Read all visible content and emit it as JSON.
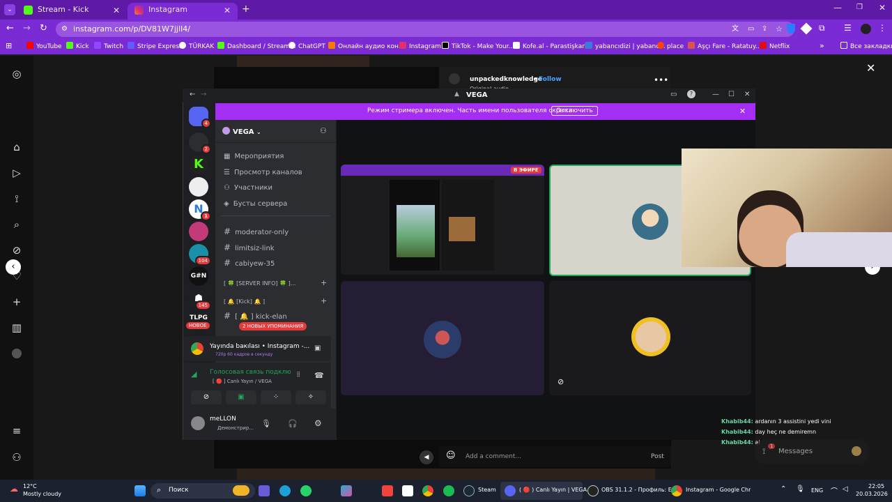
{
  "browser": {
    "tabs": [
      {
        "title": "Stream - Kick Dashboard",
        "color": "#53fc18"
      },
      {
        "title": "Instagram",
        "color": "#e1306c"
      }
    ],
    "url": "instagram.com/p/DV81W7jjlI4/",
    "bookmarks": [
      {
        "label": "YouTube",
        "color": "#ff0000"
      },
      {
        "label": "Kick",
        "color": "#53fc18"
      },
      {
        "label": "Twitch",
        "color": "#9146ff"
      },
      {
        "label": "Stripe Express",
        "color": "#635bff"
      },
      {
        "label": "TÜRKAK",
        "color": "#ffffff"
      },
      {
        "label": "Dashboard / Stream...",
        "color": "#53fc18"
      },
      {
        "label": "ChatGPT",
        "color": "#ffffff"
      },
      {
        "label": "Онлайн аудио кон...",
        "color": "#f57c00"
      },
      {
        "label": "Instagram",
        "color": "#e1306c"
      },
      {
        "label": "TikTok - Make Your...",
        "color": "#000000"
      },
      {
        "label": "Kofe.al - Parastişkarl...",
        "color": "#ffffff"
      },
      {
        "label": "yabancıdizi | yabanc...",
        "color": "#3d7bd8"
      },
      {
        "label": "place",
        "color": "#ff4500"
      },
      {
        "label": "Aşçı Fare - Ratatuy...",
        "color": "#d9534f"
      },
      {
        "label": "Netflix",
        "color": "#e50914"
      }
    ],
    "all_bookmarks": "Все закладки"
  },
  "instagram": {
    "username": "unpackedknowledge",
    "follow": "Follow",
    "audio": "Original audio",
    "comment_placeholder": "Add a comment...",
    "post": "Post",
    "messages": "Messages",
    "messages_badge": "1"
  },
  "discord": {
    "title": "VEGA",
    "banner_text": "Режим стримера включен. Часть имени пользователя скрыта.",
    "banner_button": "Отключить",
    "server_name": "VEGA",
    "menu": [
      "Мероприятия",
      "Просмотр каналов",
      "Участники",
      "Бусты сервера"
    ],
    "channels": [
      "moderator-only",
      "limitsiz-link",
      "cabiyew-35"
    ],
    "categories": [
      "[ 🍀 [SERVER INFO] 🍀 ]...",
      "[ 🔔 [Kick] 🔔 ]"
    ],
    "kick_channel": "[ 🔔 ] kick-elan",
    "new_label": "НОВОЕ",
    "mentions": "2 НОВЫХ УПОМИНАНИЯ",
    "server_badges": [
      "4",
      "2",
      "1",
      "104",
      "145"
    ],
    "server_text": [
      "G#N",
      "TLPG"
    ],
    "stream_title": "Yayında bакılası • Instagram -...",
    "stream_sub": "720p 60 кадров в секунду",
    "voice_status": "Голосовая связь подклю",
    "voice_channel": "[ 🔴 ] Canlı Yayın / VEGA",
    "user_name": "meLLON",
    "user_status": "Демонстрир...",
    "live_badge": "В ЭФИРЕ"
  },
  "chat": [
    {
      "user": "Khabib44:",
      "text": "ardanın 3 assistini yedi vini"
    },
    {
      "user": "Khabib44:",
      "text": "day heç ne demiremn"
    },
    {
      "user": "Khabib44:",
      "text": "ai"
    }
  ],
  "taskbar": {
    "weather_temp": "12°C",
    "weather_desc": "Mostly cloudy",
    "search": "Поиск",
    "apps": [
      "Steam",
      "( 🔴 ) Canlı Yayın | VEGA",
      "OBS 31.1.2 - Профиль: E",
      "Instagram - Google Chr"
    ],
    "lang": "ENG",
    "time": "22:05",
    "date": "20.03.2026"
  }
}
